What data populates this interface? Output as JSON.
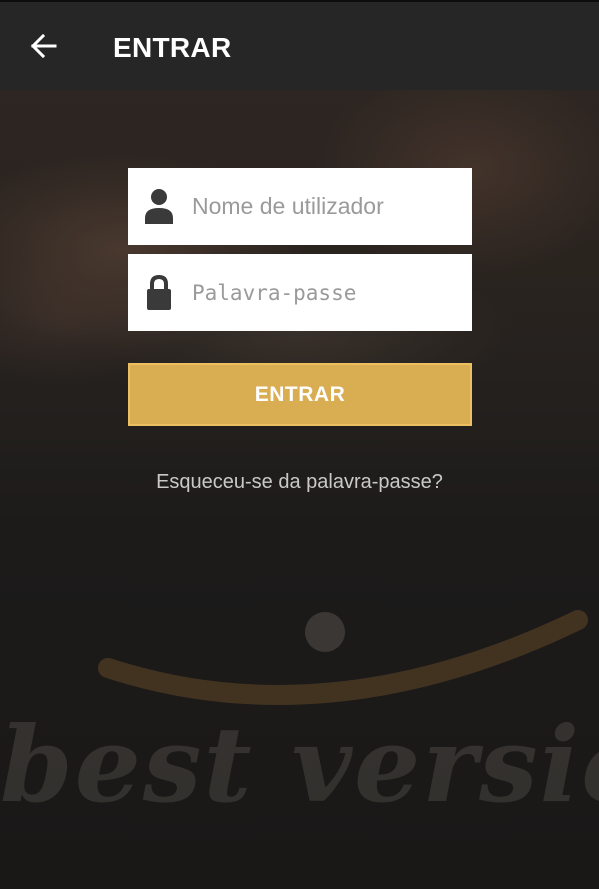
{
  "appbar": {
    "back_icon": "arrow-left-icon",
    "title": "ENTRAR"
  },
  "form": {
    "username": {
      "icon": "person-icon",
      "value": "",
      "placeholder": "Nome de utilizador"
    },
    "password": {
      "icon": "lock-icon",
      "value": "",
      "placeholder": "Palavra-passe"
    },
    "submit_label": "ENTRAR",
    "forgot_label": "Esqueceu-se da palavra-passe?"
  },
  "branding": {
    "watermark_text": "best version"
  },
  "colors": {
    "appbar": "#262626",
    "accent": "#d9ad52",
    "background": "#1e1e1e",
    "link": "#c9c9c9"
  }
}
